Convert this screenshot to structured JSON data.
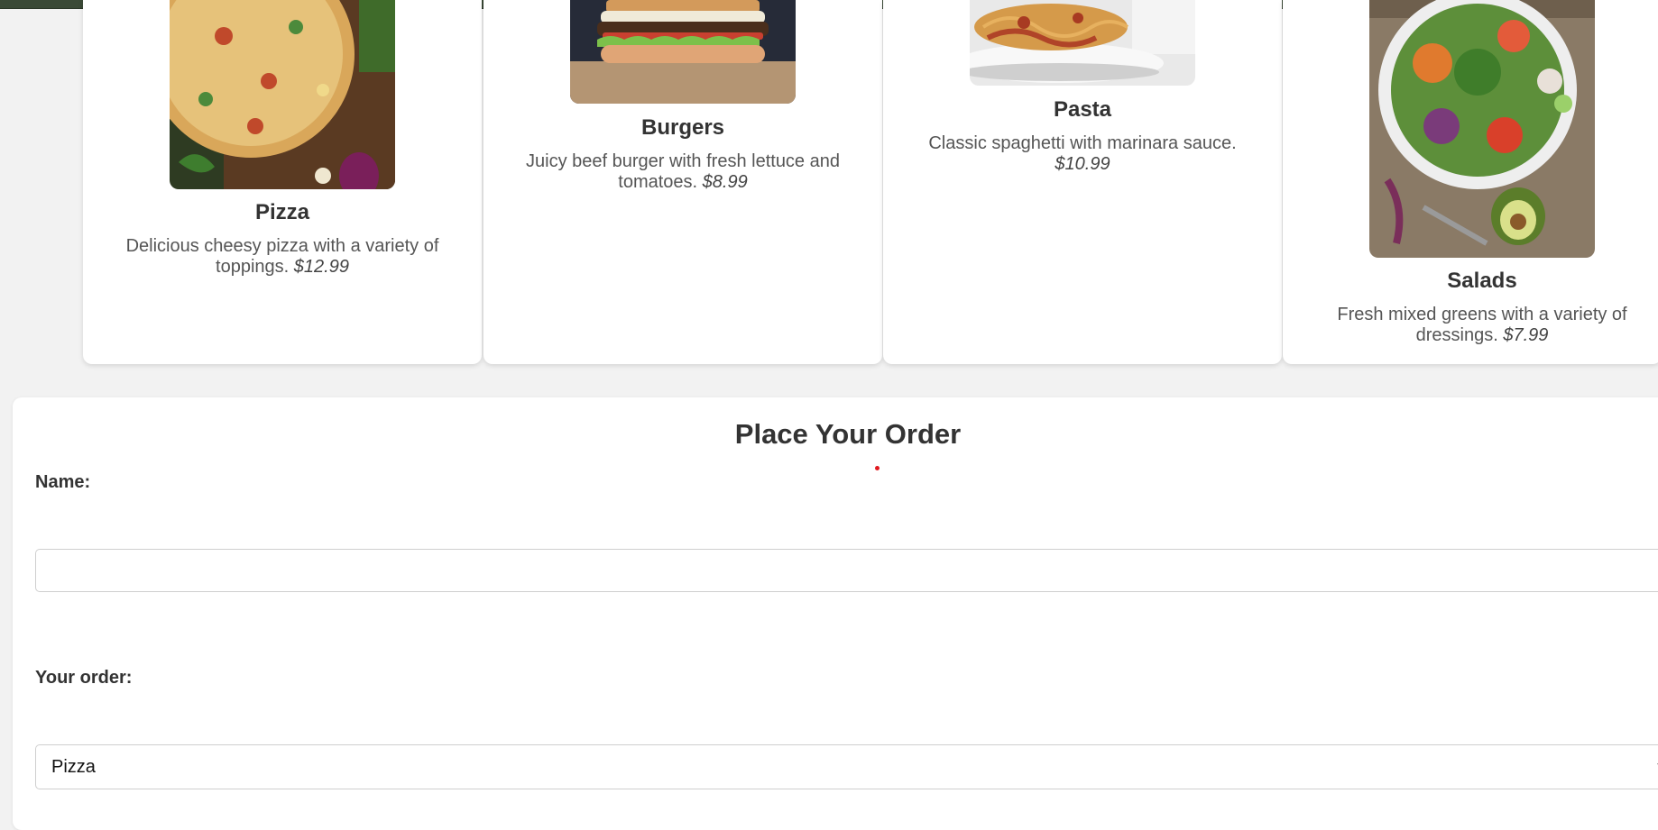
{
  "menu": {
    "items": [
      {
        "name": "Pizza",
        "description": "Delicious cheesy pizza with a variety of toppings.",
        "price": "$12.99"
      },
      {
        "name": "Burgers",
        "description": "Juicy beef burger with fresh lettuce and tomatoes.",
        "price": "$8.99"
      },
      {
        "name": "Pasta",
        "description": "Classic spaghetti with marinara sauce.",
        "price": "$10.99"
      },
      {
        "name": "Salads",
        "description": "Fresh mixed greens with a variety of dressings.",
        "price": "$7.99"
      }
    ]
  },
  "order_form": {
    "title": "Place Your Order",
    "name_label": "Name:",
    "name_value": "",
    "order_label": "Your order:",
    "order_selected": "Pizza"
  },
  "colors": {
    "topbar": "#3b4a37",
    "card_bg": "#ffffff",
    "page_bg": "#f2f2f2",
    "accent_dot": "#e0191e"
  },
  "icons": {
    "select_arrow": "chevron-down-icon"
  }
}
